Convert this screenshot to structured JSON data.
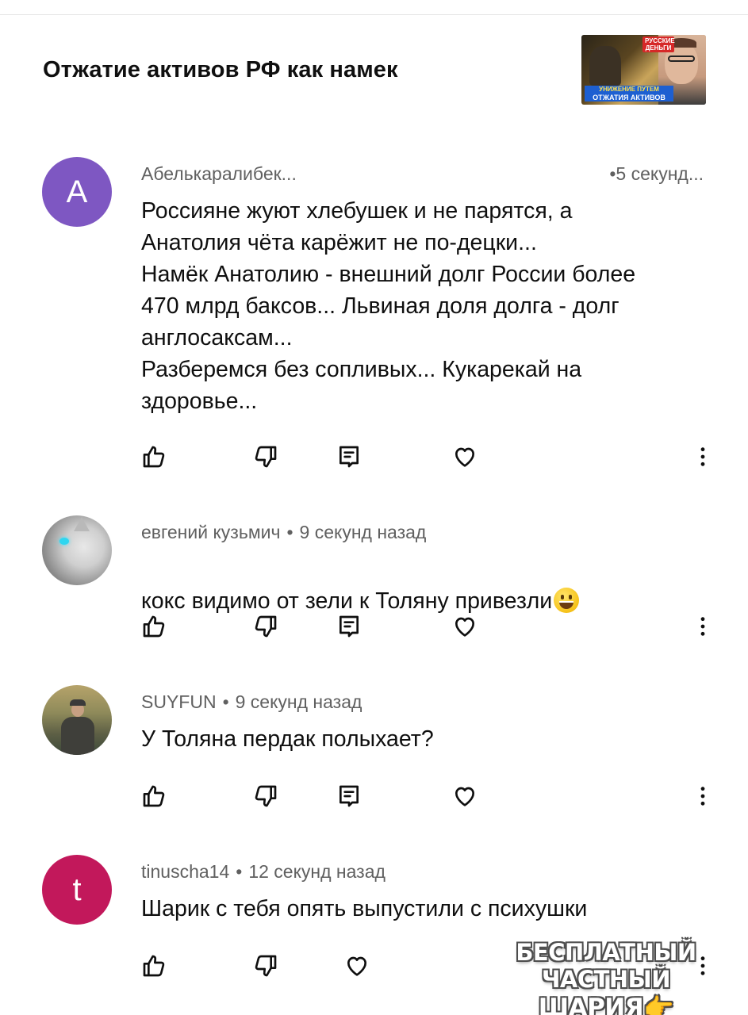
{
  "video": {
    "title": "Отжатие активов РФ как намек",
    "thumbnail": {
      "badge": "РУССКИЕ ДЕНЬГИ",
      "caption_line1": "УНИЖЕНИЕ ПУТЕМ",
      "caption_line2": "ОТЖАТИЯ АКТИВОВ"
    }
  },
  "comments": [
    {
      "author": "Абелькаралибек...",
      "time": "5 секунд...",
      "avatar_letter": "A",
      "text": "Россияне жуют хлебушек и не парятся, а\nАнатолия чёта карёжит не по-децки...\nНамёк Анатолию - внешний долг России более\n470 млрд баксов... Львиная доля долга - долг\nанглосаксам...\nРазберемся без сопливых... Кукарекай на\nздоровье..."
    },
    {
      "author": "евгений кузьмич",
      "time": "9 секунд назад",
      "text": "кокс видимо от зели к Толяну привезли"
    },
    {
      "author": "SUYFUN",
      "time": "9 секунд назад",
      "text": "У Толяна пердак полыхает?"
    },
    {
      "author": "tinuscha14",
      "time": "12 секунд назад",
      "avatar_letter": "t",
      "text": "Шарик с тебя опять выпустили с психушки"
    }
  ],
  "watermark": {
    "line1": "БЕСПЛАТНЫЙ ЧАСТНЫЙ",
    "line2": "ШАРИЯ👉Sharij.net"
  },
  "icons": {
    "like": "thumb-up-icon",
    "dislike": "thumb-down-icon",
    "reply": "reply-icon",
    "heart": "heart-icon",
    "more": "more-vertical-icon"
  }
}
